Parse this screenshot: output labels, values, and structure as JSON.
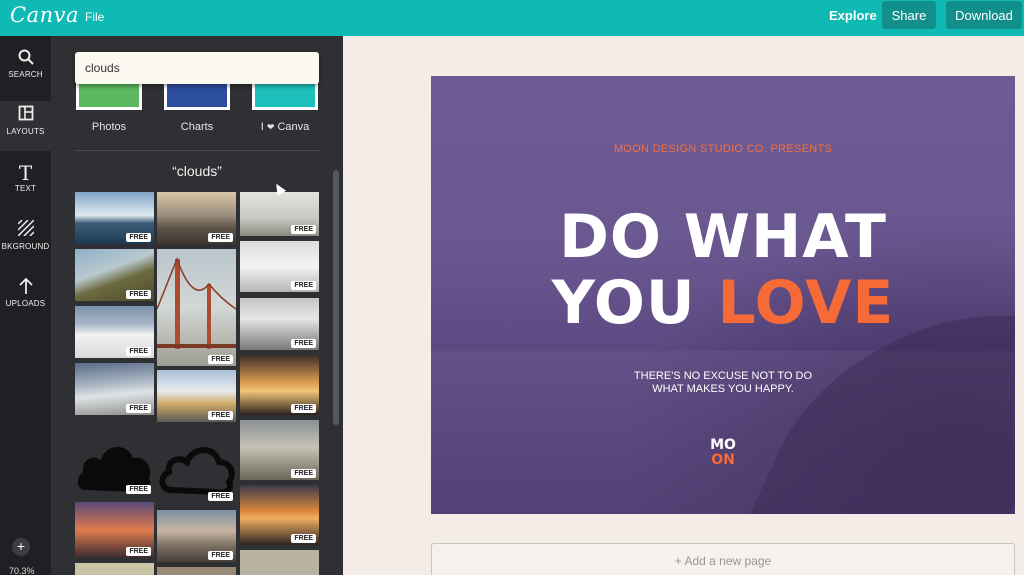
{
  "app": {
    "logo": "Canva",
    "menu_file": "File",
    "explore": "Explore",
    "share": "Share",
    "download": "Download"
  },
  "rail": {
    "items": [
      {
        "label": "SEARCH",
        "icon": "search-icon"
      },
      {
        "label": "LAYOUTS",
        "icon": "layouts-icon"
      },
      {
        "label": "TEXT",
        "icon": "text-icon"
      },
      {
        "label": "BKGROUND",
        "icon": "background-icon"
      },
      {
        "label": "UPLOADS",
        "icon": "upload-icon"
      }
    ],
    "zoom": "70.3%"
  },
  "panel": {
    "search_value": "clouds",
    "categories": [
      {
        "label": "Photos"
      },
      {
        "label": "Charts"
      },
      {
        "label_pre": "I",
        "label_post": "Canva"
      }
    ],
    "results_title": "“clouds”",
    "badge": "FREE"
  },
  "design": {
    "presents": "MOON DESIGN STUDIO CO. PRESENTS",
    "line1": "DO WHAT",
    "line2_white": "YOU",
    "line2_accent": "LOVE",
    "tagline1": "THERE'S NO EXCUSE NOT TO DO",
    "tagline2": "WHAT MAKES YOU HAPPY.",
    "logo_top": "MO",
    "logo_bottom": "ON"
  },
  "add_page": "+ Add a new page",
  "colors": {
    "topbar": "#0fb9b4",
    "button": "#128f8b",
    "accent_orange": "#f56a36",
    "design_bg": "#6a5790"
  }
}
